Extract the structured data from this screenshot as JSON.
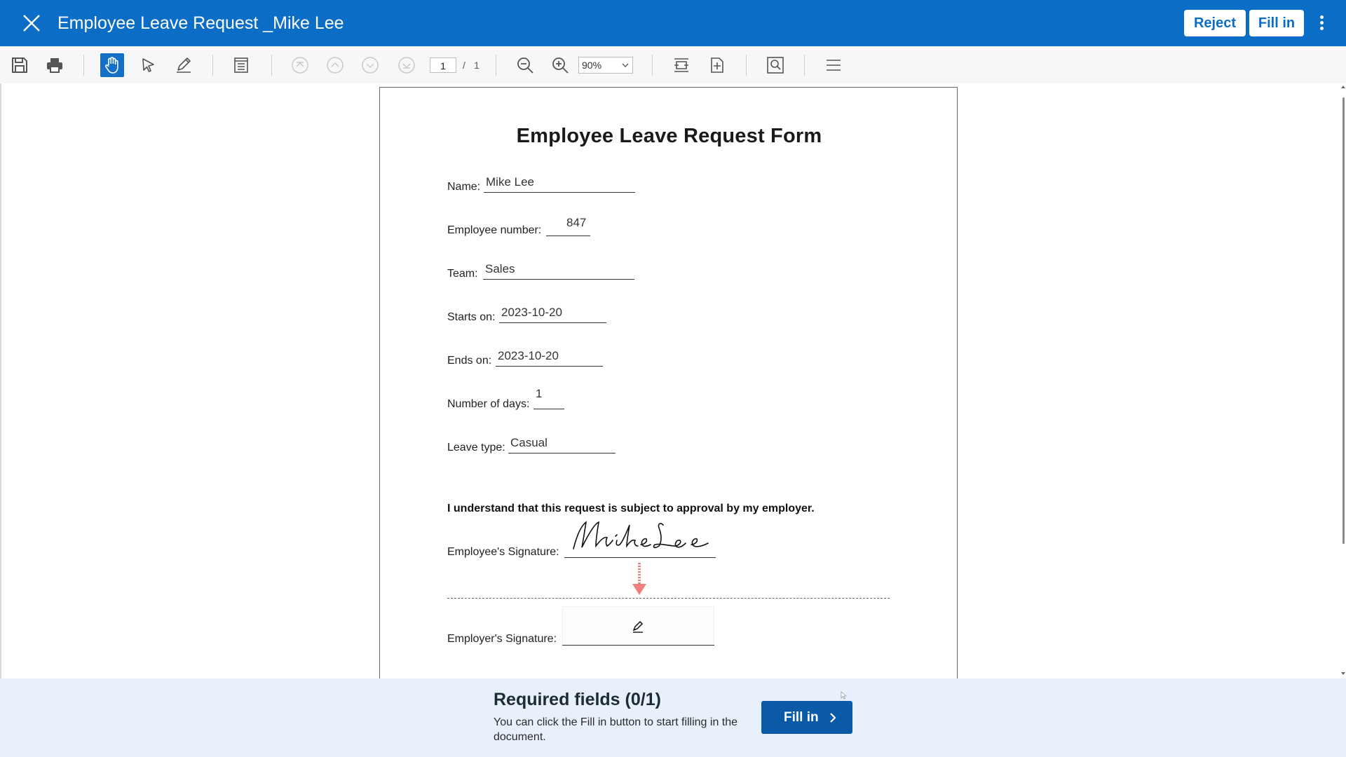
{
  "header": {
    "title": "Employee Leave Request _Mike Lee",
    "reject_label": "Reject",
    "fill_in_label": "Fill in",
    "background_color": "#0b6dc6"
  },
  "toolbar": {
    "icons": [
      "save-icon",
      "print-icon",
      "hand-tool-icon",
      "select-tool-icon",
      "annotate-pen-icon",
      "thumbnails-icon",
      "first-page-icon",
      "previous-page-icon",
      "next-page-icon",
      "last-page-icon",
      "zoom-out-icon",
      "zoom-in-icon",
      "fit-width-icon",
      "fit-page-icon",
      "search-icon",
      "menu-icon"
    ],
    "active_tool": "hand-tool-icon",
    "page_current": "1",
    "page_separator": "/",
    "page_total": "1",
    "zoom": "90%"
  },
  "form": {
    "title": "Employee Leave Request Form",
    "fields": {
      "name": {
        "label": "Name:",
        "value": "Mike Lee"
      },
      "employee_number": {
        "label": "Employee number:",
        "value": "847"
      },
      "team": {
        "label": "Team:",
        "value": "Sales"
      },
      "starts_on": {
        "label": "Starts on:",
        "value": "2023-10-20"
      },
      "ends_on": {
        "label": "Ends on:",
        "value": "2023-10-20"
      },
      "number_of_days": {
        "label": "Number of days:",
        "value": "1"
      },
      "leave_type": {
        "label": "Leave type:",
        "value": "Casual"
      }
    },
    "statement": "I understand that this request is subject to approval by my employer.",
    "employee_signature": {
      "label": "Employee's Signature:",
      "signed_name": "Mike Lee"
    },
    "employer_signature": {
      "label": "Employer's Signature:",
      "status": "unsigned"
    },
    "arrow_color": "#f08080"
  },
  "footer": {
    "required_title": "Required fields (0/1)",
    "required_desc": "You can click the Fill in button to start filling in the document.",
    "fill_in_label": "Fill in",
    "button_color": "#0b5aa8"
  }
}
